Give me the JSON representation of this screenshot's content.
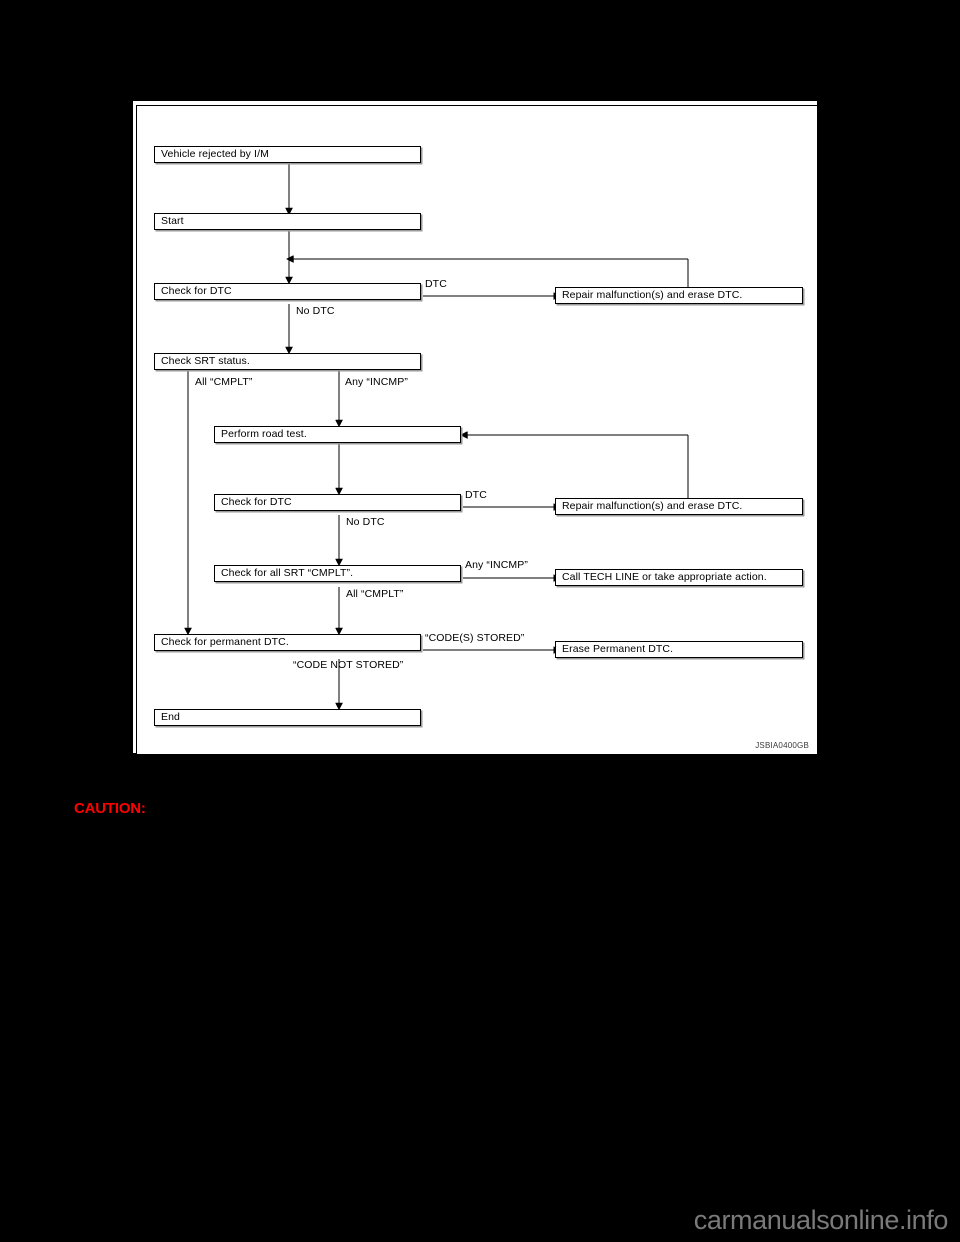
{
  "page": {
    "background_color": "#000000",
    "caution_label": "CAUTION:",
    "caution_color": "#ff0000",
    "watermark": "carmanualsonline.info",
    "watermark_color": "#7a7a7a"
  },
  "figure": {
    "id_label": "JSBIA0400GB",
    "background_color": "#ffffff",
    "border_color": "#000000",
    "type": "flowchart",
    "title": "",
    "nodes": [
      {
        "key": "vehicle_rejected",
        "label": "Vehicle rejected by I/M"
      },
      {
        "key": "start",
        "label": "Start"
      },
      {
        "key": "check_dtc_1",
        "label": "Check for DTC"
      },
      {
        "key": "check_srt_status",
        "label": "Check SRT status."
      },
      {
        "key": "perform_road_test",
        "label": "Perform road test."
      },
      {
        "key": "check_dtc_2",
        "label": "Check for DTC"
      },
      {
        "key": "check_all_srt",
        "label": "Check for all SRT “CMPLT”."
      },
      {
        "key": "check_permanent",
        "label": "Check for permanent DTC."
      },
      {
        "key": "end",
        "label": "End"
      },
      {
        "key": "repair_1",
        "label": "Repair malfunction(s) and erase DTC."
      },
      {
        "key": "repair_2",
        "label": "Repair malfunction(s) and erase DTC."
      },
      {
        "key": "call_tech_line",
        "label": "Call TECH LINE or take appropriate action."
      },
      {
        "key": "erase_permanent",
        "label": "Erase Permanent DTC."
      }
    ],
    "edge_labels": [
      {
        "key": "dtc_1",
        "label": "DTC"
      },
      {
        "key": "no_dtc_1",
        "label": "No DTC"
      },
      {
        "key": "all_cmplt_1",
        "label": "All “CMPLT”"
      },
      {
        "key": "any_incmp_1",
        "label": "Any “INCMP”"
      },
      {
        "key": "dtc_2",
        "label": "DTC"
      },
      {
        "key": "no_dtc_2",
        "label": "No DTC"
      },
      {
        "key": "any_incmp_2",
        "label": "Any “INCMP”"
      },
      {
        "key": "all_cmplt_2",
        "label": "All “CMPLT”"
      },
      {
        "key": "codes_stored",
        "label": "“CODE(S) STORED”"
      },
      {
        "key": "code_not_stored",
        "label": "“CODE NOT STORED”"
      }
    ]
  }
}
